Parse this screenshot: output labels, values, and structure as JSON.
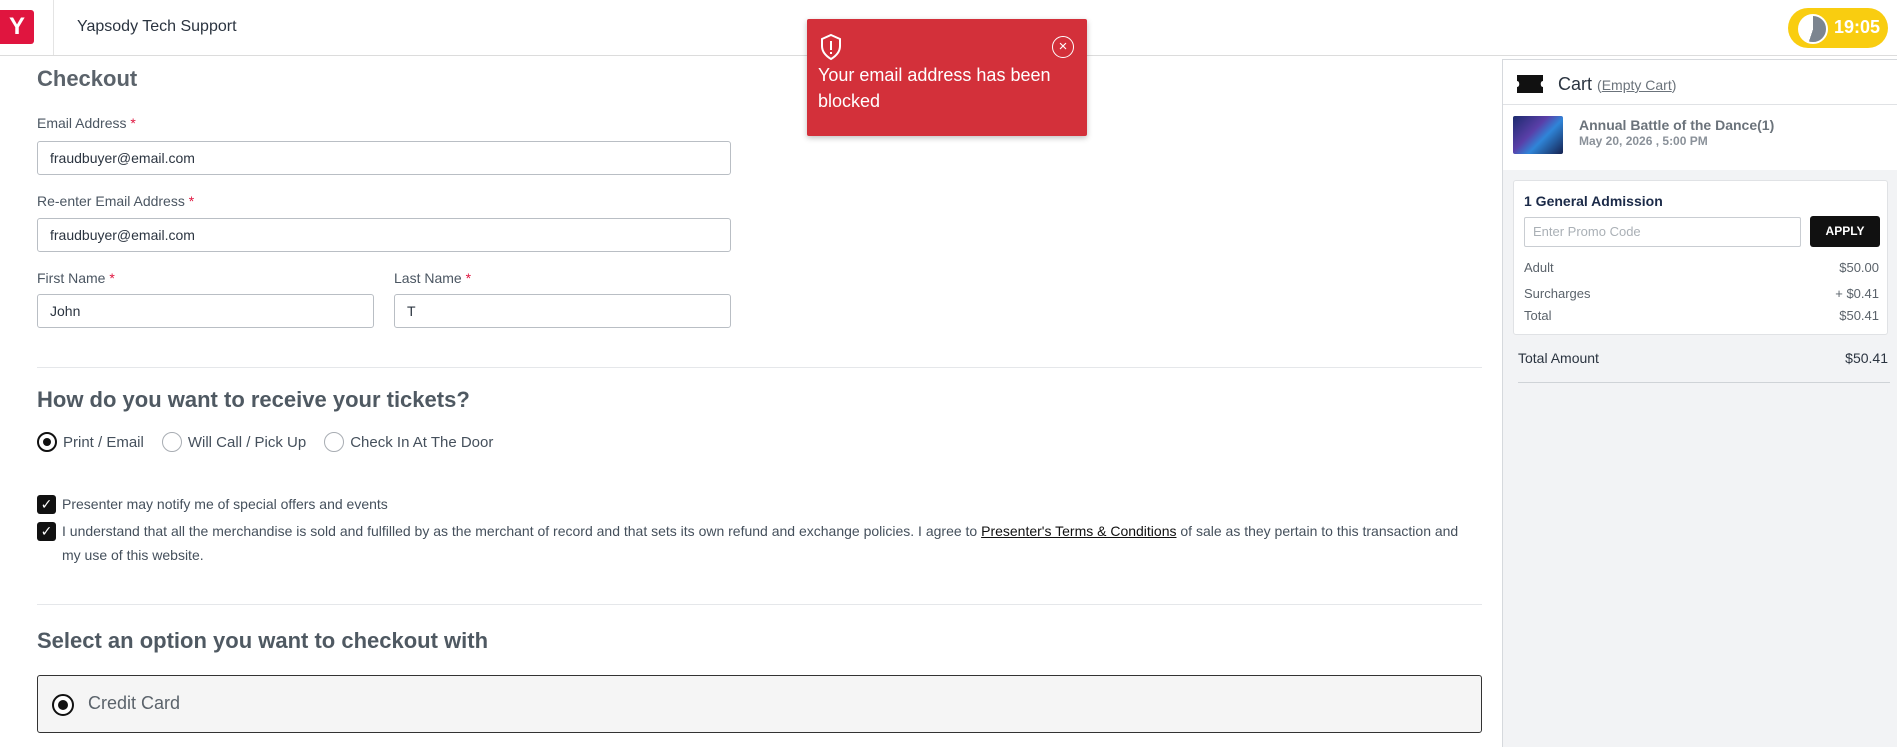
{
  "header": {
    "logo_letter": "Y",
    "org_name": "Yapsody Tech Support",
    "timer": "19:05"
  },
  "alert": {
    "message": "Your email address has been blocked",
    "close_symbol": "×"
  },
  "checkout": {
    "title": "Checkout",
    "email_label": "Email Address",
    "email_value": "fraudbuyer@email.com",
    "reemail_label": "Re-enter Email Address",
    "reemail_value": "fraudbuyer@email.com",
    "first_name_label": "First Name",
    "first_name_value": "John",
    "last_name_label": "Last Name",
    "last_name_value": "T",
    "required_mark": "*"
  },
  "delivery": {
    "title": "How do you want to receive your tickets?",
    "options": [
      {
        "label": "Print / Email",
        "selected": true
      },
      {
        "label": "Will Call / Pick Up",
        "selected": false
      },
      {
        "label": "Check In At The Door",
        "selected": false
      }
    ]
  },
  "consents": {
    "notify_text": "Presenter may notify me of special offers and events",
    "terms_prefix": "I understand that all the merchandise is sold and fulfilled by as the merchant of record and that sets its own refund and exchange policies. I agree to ",
    "terms_link": "Presenter's Terms & Conditions",
    "terms_suffix": " of sale as they pertain to this transaction and my use of this website."
  },
  "payment": {
    "title": "Select an option you want to checkout with",
    "option_label": "Credit Card"
  },
  "cart": {
    "title": "Cart",
    "empty_link": "Empty Cart",
    "event_name": "Annual Battle of the Dance(1)",
    "event_date": "May 20, 2026 , 5:00 PM",
    "ticket_title": "1 General Admission",
    "promo_placeholder": "Enter Promo Code",
    "apply_label": "APPLY",
    "adult_label": "Adult",
    "adult_value": "$50.00",
    "surcharges_label": "Surcharges",
    "surcharges_value": "+ $0.41",
    "total_label": "Total",
    "total_value": "$50.41",
    "total_amount_label": "Total Amount",
    "total_amount_value": "$50.41"
  }
}
